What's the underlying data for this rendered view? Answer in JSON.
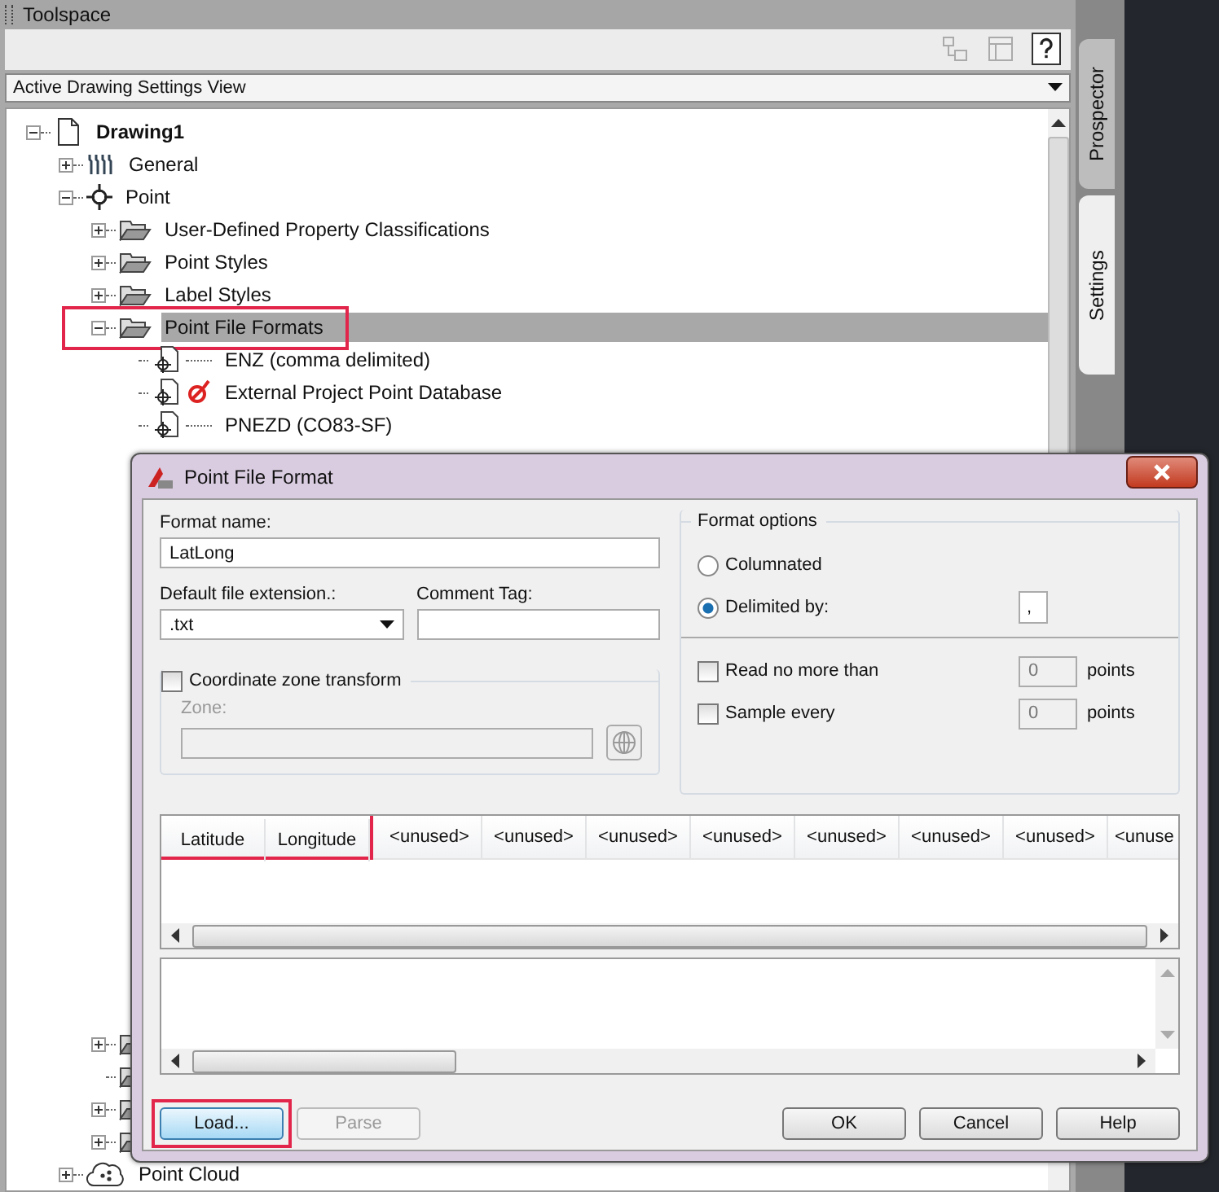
{
  "toolspace": {
    "title": "Toolspace",
    "view_selector": "Active Drawing Settings View",
    "side_tabs": [
      {
        "label": "Prospector",
        "selected": false
      },
      {
        "label": "Settings",
        "selected": true
      }
    ]
  },
  "tree": [
    {
      "label": "Drawing1",
      "kind": "drawing",
      "expanded": true,
      "selected": false,
      "children": [
        {
          "label": "General",
          "kind": "tools",
          "expanded": false,
          "selected": false
        },
        {
          "label": "Point",
          "kind": "point",
          "expanded": true,
          "selected": false,
          "children": [
            {
              "label": "User-Defined Property Classifications",
              "kind": "folder",
              "expanded": false,
              "selected": false
            },
            {
              "label": "Point Styles",
              "kind": "folder",
              "expanded": false,
              "selected": false
            },
            {
              "label": "Label Styles",
              "kind": "folder",
              "expanded": false,
              "selected": false
            },
            {
              "label": "Point File Formats",
              "kind": "folder",
              "expanded": true,
              "selected": true,
              "highlighted": true,
              "children": [
                {
                  "label": "ENZ (comma delimited)",
                  "kind": "format",
                  "status_icon": false,
                  "selected": false
                },
                {
                  "label": "External Project Point Database",
                  "kind": "format",
                  "status_icon": true,
                  "selected": false
                },
                {
                  "label": "PNEZD (CO83-SF)",
                  "kind": "format",
                  "status_icon": false,
                  "selected": false
                }
              ]
            },
            {
              "kind": "folder",
              "expanded": false
            },
            {
              "kind": "folder"
            },
            {
              "kind": "folder",
              "expanded": false
            },
            {
              "kind": "folder",
              "expanded": false
            }
          ]
        },
        {
          "label": "Point Cloud",
          "kind": "cloud",
          "expanded": false,
          "selected": false
        }
      ]
    }
  ],
  "dialog": {
    "title": "Point File Format",
    "format_name": {
      "label": "Format name:",
      "value": "LatLong"
    },
    "file_extension": {
      "label": "Default file extension.:",
      "value": ".txt"
    },
    "comment_tag": {
      "label": "Comment Tag:"
    },
    "zone_transform": {
      "label": "Coordinate zone transform",
      "checked": false,
      "zone_label": "Zone:"
    },
    "format_options": {
      "title": "Format options",
      "modes": [
        {
          "label": "Columnated",
          "selected": false
        },
        {
          "label": "Delimited by:",
          "selected": true,
          "value": ","
        }
      ],
      "limits": [
        {
          "label": "Read no more than",
          "checked": false,
          "value": "0",
          "unit": "points"
        },
        {
          "label": "Sample every",
          "checked": false,
          "value": "0",
          "unit": "points"
        }
      ]
    },
    "columns": [
      {
        "label": "Latitude",
        "highlighted": true
      },
      {
        "label": "Longitude",
        "highlighted": true
      },
      {
        "label": "<unused>"
      },
      {
        "label": "<unused>"
      },
      {
        "label": "<unused>"
      },
      {
        "label": "<unused>"
      },
      {
        "label": "<unused>"
      },
      {
        "label": "<unused>"
      },
      {
        "label": "<unused>"
      },
      {
        "label": "<unuse"
      }
    ],
    "buttons": [
      {
        "label": "Load...",
        "kind": "left",
        "focused": true,
        "disabled": false,
        "highlighted": true
      },
      {
        "label": "Parse",
        "kind": "left",
        "focused": false,
        "disabled": true
      },
      {
        "label": "OK",
        "kind": "right",
        "focused": false,
        "disabled": false
      },
      {
        "label": "Cancel",
        "kind": "right",
        "focused": false,
        "disabled": false
      },
      {
        "label": "Help",
        "kind": "right",
        "focused": false,
        "disabled": false
      }
    ]
  }
}
